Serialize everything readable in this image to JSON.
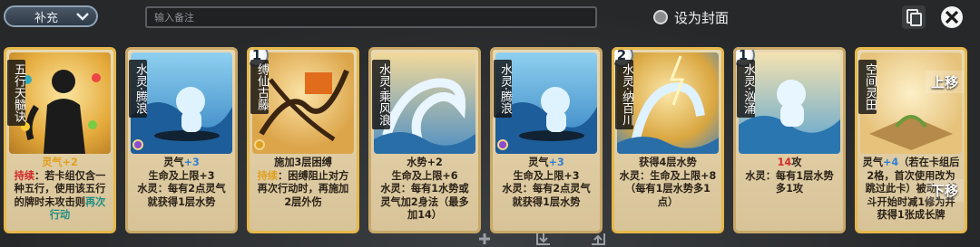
{
  "toolbar": {
    "dropdown_label": "补充",
    "note_placeholder": "输入备注",
    "cover_label": "设为封面"
  },
  "cards": [
    {
      "name": "五行天髓诀",
      "desc_html": "<span class='gold-t'>灵气+2</span><br><span class='red'>持续</span>：若卡组仅含一种五行，使用该五行的牌时未攻击则<span class='teal'>再次行动</span>"
    },
    {
      "name": "水灵·腾浪",
      "desc_html": "灵气<span class='blue'>+3</span><br>生命及上限+3<br>水灵：每有2点灵气就获得1层水势"
    },
    {
      "name": "缚仙古藤",
      "cost": "1",
      "desc_html": "施加3层困缚<br><span class='gold-t'>持续</span>：困缚阻止对方再次行动时，再施加2层外伤"
    },
    {
      "name": "水灵·乘风浪",
      "desc_html": "水势+2<br>生命及上限+6<br>水灵：每有1水势或灵气加2身法（最多加14）"
    },
    {
      "name": "水灵·腾浪",
      "desc_html": "灵气<span class='blue'>+3</span><br>生命及上限+3<br>水灵：每有2点灵气就获得1层水势"
    },
    {
      "name": "水灵·纳百川",
      "cost": "2",
      "desc_html": "获得4层水势<br>水灵：生命及上限+8（每有1层水势多1点）"
    },
    {
      "name": "水灵·汹涌",
      "cost": "1",
      "desc_html": "<span class='red'>14</span>攻<br>水灵：每有1层水势多1攻"
    },
    {
      "name": "空间灵田",
      "overlay_top": "上移",
      "overlay_bottom": "下移",
      "desc_html": "灵气<span class='blue'>+4</span>（若在卡组后2格，首次使用改为跳过此卡）被动：战斗开始时减1修为并获得1张成长牌"
    }
  ]
}
